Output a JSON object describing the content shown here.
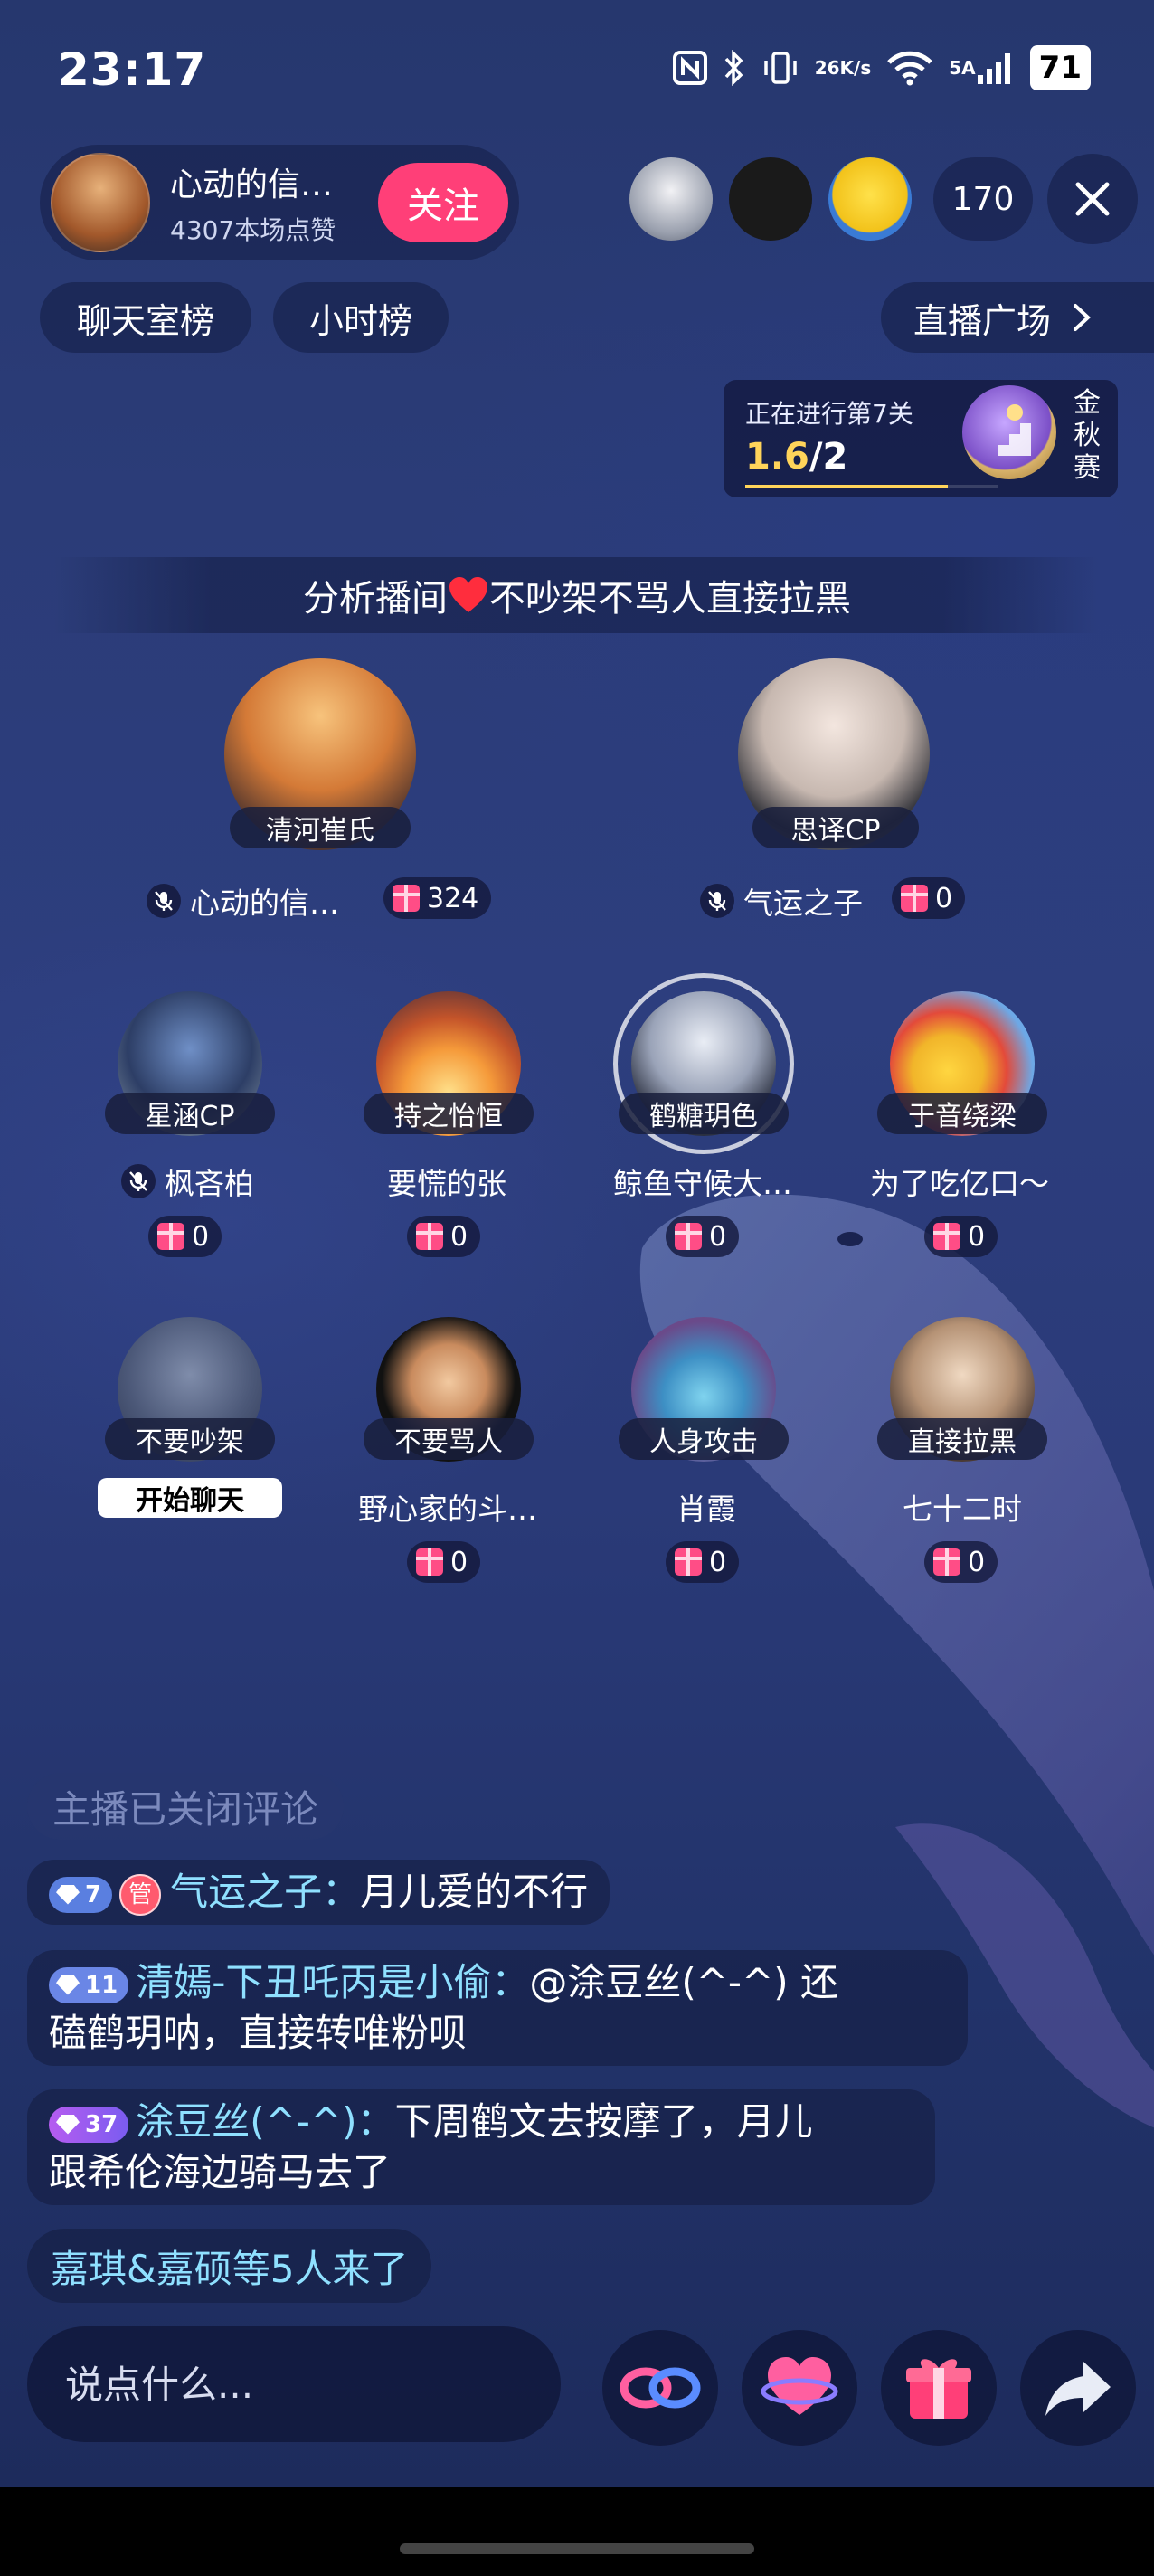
{
  "status_bar": {
    "time": "23:17",
    "net_speed_top": "26",
    "net_speed_bottom": "K/s",
    "signal_label": "5A",
    "battery": "71"
  },
  "host": {
    "name": "心动的信…",
    "likes": "4307本场点赞",
    "follow_label": "关注"
  },
  "viewers": {
    "count": "170"
  },
  "chips": {
    "chatroom_rank": "聊天室榜",
    "hourly_rank": "小时榜",
    "plaza": "直播广场"
  },
  "level_card": {
    "title": "正在进行第7关",
    "current": "1.6",
    "total": "/2",
    "progress_fraction": 0.8,
    "season_chars": [
      "金",
      "秋",
      "赛"
    ]
  },
  "room_title": {
    "before": "分析播间",
    "after": "不吵架不骂人直接拉黑"
  },
  "seats": {
    "main": [
      {
        "label": "清河崔氏",
        "name": "心动的信…",
        "gifts": "324"
      },
      {
        "label": "思译CP",
        "name": "气运之子",
        "gifts": "0"
      }
    ],
    "row2": [
      {
        "label": "星涵CP",
        "name": "枫吝柏",
        "gifts": "0"
      },
      {
        "label": "持之怡恒",
        "name": "要慌的张",
        "gifts": "0"
      },
      {
        "label": "鹤糖玥色",
        "name": "鲸鱼守候大…",
        "gifts": "0"
      },
      {
        "label": "于音绕梁",
        "name": "为了吃亿口～",
        "gifts": "0"
      }
    ],
    "row3": [
      {
        "label": "不要吵架",
        "start_chat": "开始聊天"
      },
      {
        "label": "不要骂人",
        "name": "野心家的斗…",
        "gifts": "0"
      },
      {
        "label": "人身攻击",
        "name": "肖霞",
        "gifts": "0"
      },
      {
        "label": "直接拉黑",
        "name": "七十二时",
        "gifts": "0"
      }
    ]
  },
  "chat": {
    "closed_notice": "主播已关闭评论",
    "messages": [
      {
        "level": "7",
        "admin_badge": "管",
        "nick": "气运之子",
        "sep": "：",
        "line1": "月儿爱的不行",
        "line2": ""
      },
      {
        "level": "11",
        "nick": "清嫣-下丑吒丙是小偷",
        "sep": "：",
        "line1": "@涂豆丝(^-^) 还",
        "line2": "磕鹤玥呐，直接转唯粉呗"
      },
      {
        "level": "37",
        "nick": "涂豆丝(^-^)",
        "sep": "：",
        "line1": "下周鹤文去按摩了，月儿",
        "line2": "跟希伦海边骑马去了"
      }
    ],
    "arrivals": "嘉琪&嘉硕等5人来了"
  },
  "bottom": {
    "input_placeholder": "说点什么..."
  },
  "colors": {
    "follow": "#ff3f78",
    "progress": "#ffd45a",
    "nick": "#8fe0ff"
  }
}
